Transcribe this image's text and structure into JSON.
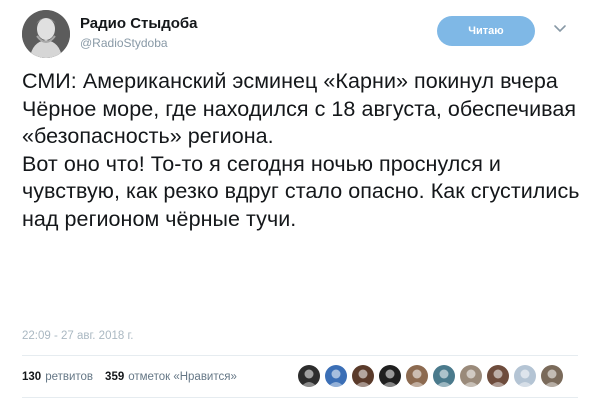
{
  "account": {
    "name": "Радио Стыдоба",
    "handle": "@RadioStydoba"
  },
  "follow_button": {
    "label": "Читаю"
  },
  "tweet": {
    "paragraph1": "СМИ: Американский эсминец «Карни» покинул вчера Чёрное море, где находился с 18 августа, обеспечивая «безопасность» региона.",
    "paragraph2": "Вот оно что! То-то я сегодня ночью проснулся и чувствую, как резко вдруг стало опасно. Как сгустились над регионом чёрные тучи.",
    "timestamp": "22:09 - 27 авг. 2018 г."
  },
  "stats": {
    "retweets_count": "130",
    "retweets_label": "ретвитов",
    "likes_count": "359",
    "likes_label": "отметок «Нравится»"
  },
  "likers": [
    {
      "icon": "liker-avatar-1",
      "color": "#2d2d2d"
    },
    {
      "icon": "liker-avatar-2",
      "color": "#3b6fb6"
    },
    {
      "icon": "liker-avatar-3",
      "color": "#5a3a2a"
    },
    {
      "icon": "liker-avatar-4",
      "color": "#1f1f1f"
    },
    {
      "icon": "liker-avatar-5",
      "color": "#8c6a50"
    },
    {
      "icon": "liker-avatar-6",
      "color": "#4a7a8c"
    },
    {
      "icon": "liker-avatar-7",
      "color": "#9a8a7a"
    },
    {
      "icon": "liker-avatar-8",
      "color": "#6e4c3c"
    },
    {
      "icon": "liker-avatar-9",
      "color": "#b4c4d4"
    },
    {
      "icon": "liker-avatar-10",
      "color": "#7a6a5a"
    }
  ],
  "colors": {
    "accent": "#7fb8e6",
    "muted": "#8899a6"
  }
}
